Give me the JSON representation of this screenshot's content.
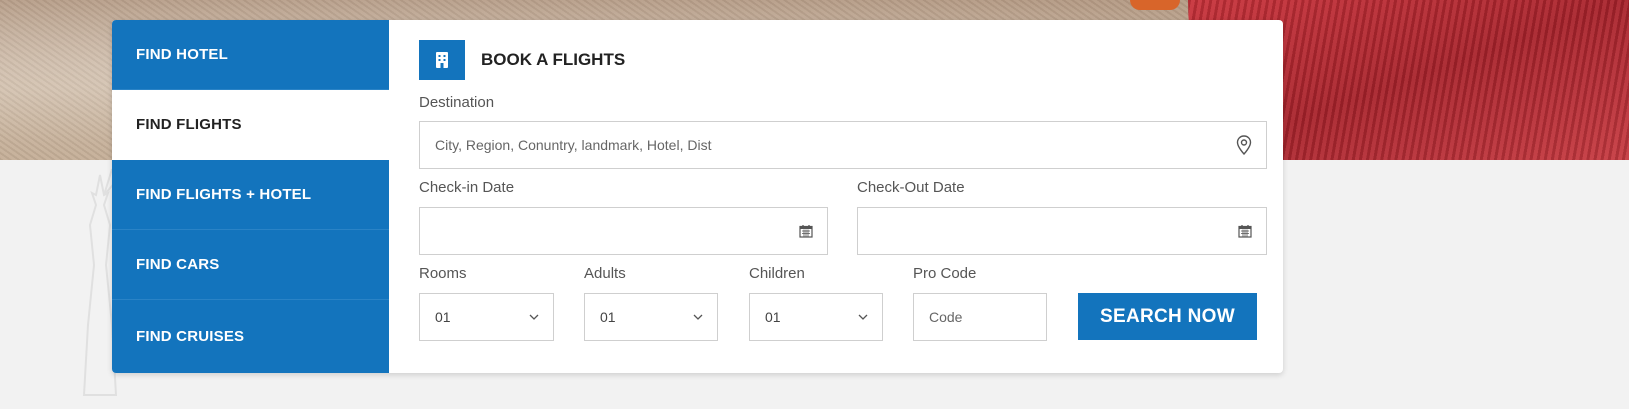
{
  "tabs": [
    {
      "label": "FIND HOTEL"
    },
    {
      "label": "FIND FLIGHTS"
    },
    {
      "label": "FIND FLIGHTS + HOTEL"
    },
    {
      "label": "FIND CARS"
    },
    {
      "label": "FIND CRUISES"
    }
  ],
  "active_tab": "FIND FLIGHTS",
  "form": {
    "title": "BOOK A FLIGHTS",
    "header_icon": "building-icon",
    "destination": {
      "label": "Destination",
      "placeholder": "City, Region, Conuntry, landmark, Hotel, Dist",
      "icon": "map-pin-icon"
    },
    "checkin": {
      "label": "Check-in Date",
      "value": "",
      "icon": "calendar-icon"
    },
    "checkout": {
      "label": "Check-Out Date",
      "value": "",
      "icon": "calendar-icon"
    },
    "rooms": {
      "label": "Rooms",
      "value": "01"
    },
    "adults": {
      "label": "Adults",
      "value": "01"
    },
    "children": {
      "label": "Children",
      "value": "01"
    },
    "promo": {
      "label": "Pro Code",
      "placeholder": "Code"
    },
    "search_button": "SEARCH NOW"
  },
  "colors": {
    "accent": "#1374bd",
    "text_dark": "#222222",
    "label": "#555555"
  }
}
